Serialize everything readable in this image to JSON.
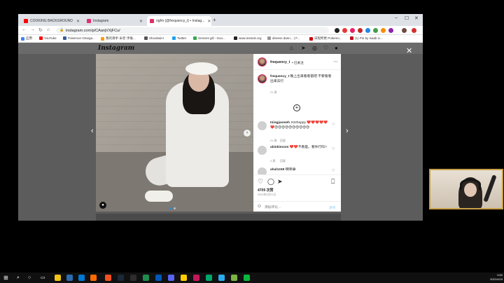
{
  "browser": {
    "tabs": [
      {
        "title": "COOKING BACKGROUND",
        "favicon_color": "#ff0000",
        "active": false
      },
      {
        "title": "Instagram",
        "favicon_color": "#e1306c",
        "active": false
      },
      {
        "title": "ogfm (@frequency_t) • Instag...",
        "favicon_color": "#e1306c",
        "active": true
      }
    ],
    "new_tab": "+",
    "url": "instagram.com/p/CAanjVXjFCu/",
    "bookmarks": [
      {
        "label": "应用",
        "color": "#4285f4"
      },
      {
        "label": "YouTube",
        "color": "#ff0000"
      },
      {
        "label": "Pokemon Omega...",
        "color": "#3b5998"
      },
      {
        "label": "我的滑手·米老·手账...",
        "color": "#ff9900"
      },
      {
        "label": "Shoobwin!",
        "color": "#555555"
      },
      {
        "label": "Twitter",
        "color": "#1da1f2"
      },
      {
        "label": "clement gill - Goo...",
        "color": "#34a853"
      },
      {
        "label": "www.instsok.org",
        "color": "#222222"
      },
      {
        "label": "direess dann... | F...",
        "color": "#999999"
      },
      {
        "label": "日程所更 Pokemo...",
        "color": "#cc0000"
      },
      {
        "label": "(1) Pin by Isaab Li...",
        "color": "#bd081c"
      }
    ]
  },
  "instagram": {
    "logo": "Instagram",
    "header_icons": [
      "home-icon",
      "direct-icon",
      "explore-icon",
      "activity-icon",
      "profile-icon"
    ],
    "post": {
      "username": "frequency_t",
      "follow_state": "• 已关注",
      "caption_user": "frequency_t",
      "caption": "晚上出来看看雷吧 不要看看出来去行",
      "caption_time": "21 周",
      "comments": [
        {
          "user": "tsingjasmeh",
          "text": "S32happy ❤️❤️❤️❤️❤️❤️😍😍😍😍😍😍😍😍😍😍",
          "time": "21 周",
          "reply": "回复"
        },
        {
          "user": "abinkiesom",
          "text": "❤️❤️不看是。看你行吗?",
          "time": "4 周",
          "reply": "回复"
        },
        {
          "user": "ahal1249",
          "text": "啊啊😂",
          "time": "",
          "reply": ""
        }
      ],
      "likes": "4709 次赞",
      "date": "2020年5月21日",
      "comment_placeholder": "添加评论...",
      "post_label": "发布"
    }
  },
  "taskbar": {
    "time": "0:52",
    "date": "2021/4/15",
    "apps": [
      "#f0c419",
      "#2b6cb0",
      "#0078d4",
      "#ff6a00",
      "#f25022",
      "#1b2838",
      "#2d2d2d",
      "#1f8b4c",
      "#0057b8",
      "#5865f2",
      "#ffcc00",
      "#c2185b",
      "#00a86b",
      "#2aabee",
      "#7cb342",
      "#09b83e"
    ]
  }
}
